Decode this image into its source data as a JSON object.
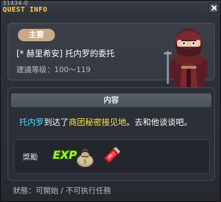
{
  "window": {
    "quest_id": "31434-0",
    "title": "QUEST INFO"
  },
  "quest": {
    "type_badge": "主要",
    "name": "[* 赫里希安] 托内罗的委托",
    "recommended_level": "建議等级：100～119"
  },
  "content": {
    "header": "内容",
    "description_npc": "托内罗",
    "description_mid": "到达了",
    "description_place": "商团秘密接见地",
    "description_end": "。去和他谈谈吧。"
  },
  "reward": {
    "label": "獎勵",
    "exp_icon": "EXP",
    "items": [
      "money-bag-icon",
      "red-crystal-item-icon"
    ]
  },
  "status": "狀態：可開始 / 不可执行任務",
  "colors": {
    "title": "#ffd34a",
    "npc_link": "#57d7ff",
    "place_link": "#ffe24a",
    "badge": "#c9a98a",
    "exp": "#a4f03a"
  }
}
